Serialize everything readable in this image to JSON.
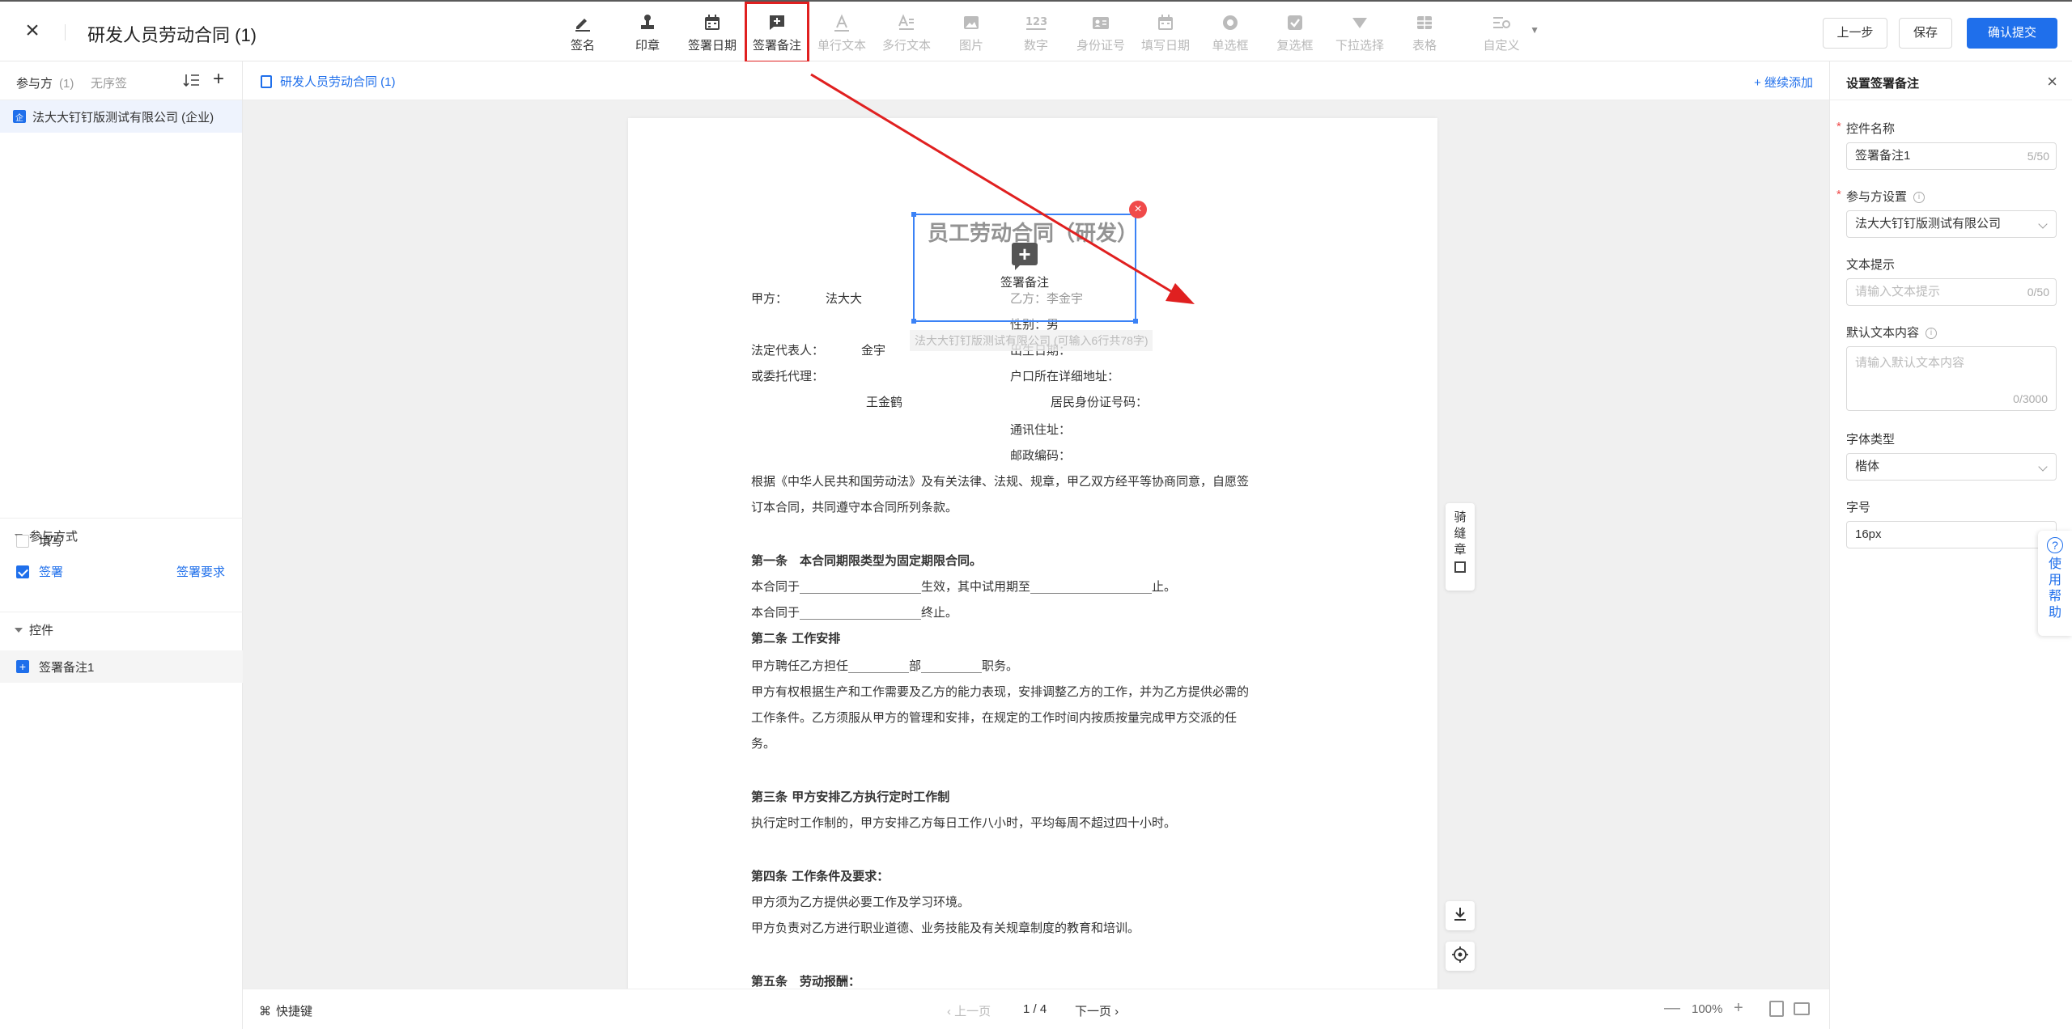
{
  "topbar": {
    "doc_title": "研发人员劳动合同 (1)",
    "tools": [
      {
        "label": "签名",
        "icon": "pen-sign-icon",
        "state": "enabled"
      },
      {
        "label": "印章",
        "icon": "stamp-icon",
        "state": "enabled"
      },
      {
        "label": "签署日期",
        "icon": "calendar-icon",
        "state": "enabled"
      },
      {
        "label": "签署备注",
        "icon": "comment-add-icon",
        "state": "selected"
      },
      {
        "label": "单行文本",
        "icon": "text-a-icon",
        "state": "disabled"
      },
      {
        "label": "多行文本",
        "icon": "multiline-text-icon",
        "state": "disabled"
      },
      {
        "label": "图片",
        "icon": "image-icon",
        "state": "disabled"
      },
      {
        "label": "数字",
        "icon": "number-icon",
        "state": "disabled"
      },
      {
        "label": "身份证号",
        "icon": "id-card-icon",
        "state": "disabled"
      },
      {
        "label": "填写日期",
        "icon": "calendar-icon",
        "state": "disabled"
      },
      {
        "label": "单选框",
        "icon": "radio-icon",
        "state": "disabled"
      },
      {
        "label": "复选框",
        "icon": "checkbox-icon",
        "state": "disabled"
      },
      {
        "label": "下拉选择",
        "icon": "dropdown-icon",
        "state": "disabled"
      },
      {
        "label": "表格",
        "icon": "table-icon",
        "state": "disabled"
      },
      {
        "label": "自定义",
        "icon": "custom-settings-icon",
        "state": "disabled"
      }
    ],
    "prev_step": "上一步",
    "save": "保存",
    "confirm_submit": "确认提交"
  },
  "left": {
    "tab_participants": "参与方",
    "tab_participants_count": "(1)",
    "tab_no_order": "无序签",
    "party_badge": "企",
    "party_name": "法大大钉钉版测试有限公司 (企业)",
    "section_method": "参与方式",
    "opt_fill": "填写",
    "opt_sign": "签署",
    "sign_requirement": "签署要求",
    "section_controls": "控件",
    "control_item": "签署备注1"
  },
  "center": {
    "file_tab": "研发人员劳动合同 (1)",
    "continue_add": "+ 继续添加",
    "seal_strip": [
      "骑",
      "缝",
      "章"
    ],
    "shortcut": "快捷键",
    "prev_page": "上一页",
    "page_num": "1 / 4",
    "next_page": "下一页",
    "zoom": "100%"
  },
  "doc": {
    "title": "员工劳动合同（研发）",
    "party_a": "甲方：",
    "party_a_name": "法大大",
    "party_b": "乙方：李金宇",
    "gender": "性别：男",
    "legal_rep": "法定代表人：",
    "legal_rep_name": "金宇",
    "birth": "出生日期：",
    "agent": "或委托代理：",
    "hukou": "户口所在详细地址：",
    "agent_name": "王金鹤",
    "id_no": "居民身份证号码：",
    "mail_addr": "通讯住址：",
    "postcode": "邮政编码：",
    "intro1": "根据《中华人民共和国劳动法》及有关法律、法规、规章，甲乙双方经平等协商同意，自愿签",
    "intro2": "订本合同，共同遵守本合同所列条款。",
    "art1_title": "第一条　本合同期限类型为固定期限合同。",
    "art1_l1": "本合同于____________________生效，其中试用期至____________________止。",
    "art1_l2": "本合同于____________________终止。",
    "art2_title": "第二条 工作安排",
    "art2_l1": "甲方聘任乙方担任__________部__________职务。",
    "art2_l2": "甲方有权根据生产和工作需要及乙方的能力表现，安排调整乙方的工作，并为乙方提供必需的",
    "art2_l3": "工作条件。乙方须服从甲方的管理和安排，在规定的工作时间内按质按量完成甲方交派的任",
    "art2_l4": "务。",
    "art3_title": "第三条 甲方安排乙方执行定时工作制",
    "art3_l1": "执行定时工作制的，甲方安排乙方每日工作八小时，平均每周不超过四十小时。",
    "art4_title": "第四条 工作条件及要求：",
    "art4_l1": "甲方须为乙方提供必要工作及学习环境。",
    "art4_l2": "甲方负责对乙方进行职业道德、业务技能及有关规章制度的教育和培训。",
    "art5_title": "第五条　劳动报酬："
  },
  "signature_box": {
    "label": "签署备注",
    "hint": "法大大钉钉版测试有限公司 (可输入6行共78字)",
    "close": "×"
  },
  "right": {
    "title": "设置签署备注",
    "name_label": "控件名称",
    "name_value": "签署备注1",
    "name_counter": "5/50",
    "party_label": "参与方设置",
    "party_value": "法大大钉钉版测试有限公司",
    "hint_label": "文本提示",
    "hint_placeholder": "请输入文本提示",
    "hint_counter": "0/50",
    "default_label": "默认文本内容",
    "default_placeholder": "请输入默认文本内容",
    "default_counter": "0/3000",
    "font_label": "字体类型",
    "font_value": "楷体",
    "size_label": "字号",
    "size_value": "16px"
  },
  "help": {
    "chars": [
      "使",
      "用",
      "帮",
      "助"
    ]
  },
  "colors": {
    "primary": "#1f6feb",
    "annotation_red": "#e02020",
    "selection_blue": "#3b82f6"
  }
}
